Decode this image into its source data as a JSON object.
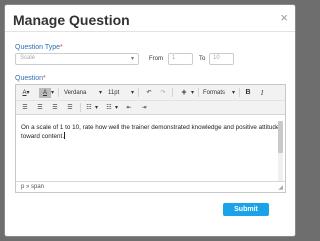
{
  "dialog": {
    "title": "Manage Question",
    "close_symbol": "×"
  },
  "question_type": {
    "label": "Question Type",
    "required_marker": "*",
    "select_value": "Scale",
    "from_label": "From",
    "from_value": "1",
    "to_label": "To",
    "to_value": "10"
  },
  "question": {
    "label": "Question",
    "required_marker": "*"
  },
  "toolbar": {
    "font_family": "Verdana",
    "font_size": "11pt",
    "formats_label": "Formats",
    "bold": "B",
    "italic": "I",
    "undo_icon": "undo-icon",
    "redo_icon": "redo-icon",
    "insert_icon": "plus-icon"
  },
  "editor": {
    "content": "On a scale of 1 to 10, rate how well the trainer demonstrated knowledge and positive attitude toward content.",
    "path": "p » span"
  },
  "submit_label": "Submit",
  "colors": {
    "accent": "#1aa3e8",
    "label_blue": "#2f6fb5",
    "required_red": "#e0453b"
  }
}
